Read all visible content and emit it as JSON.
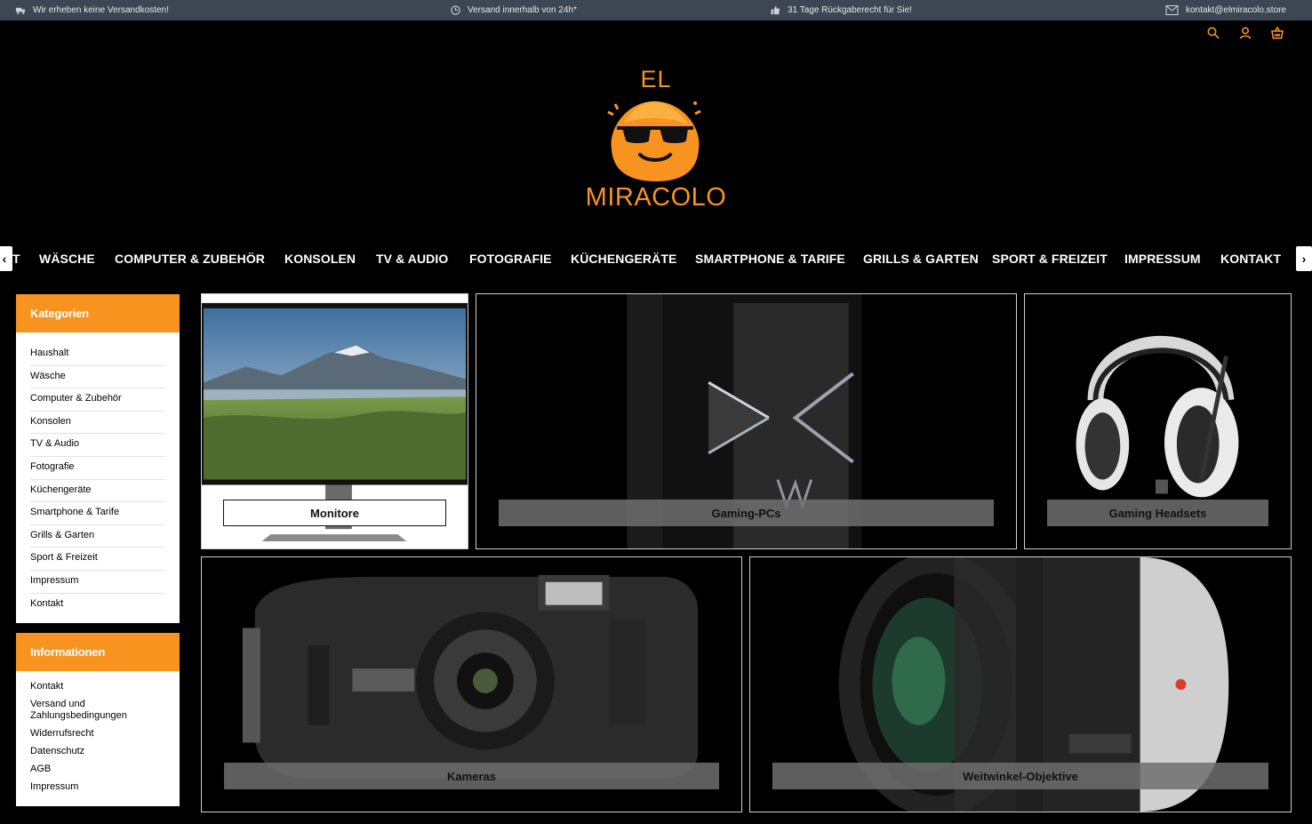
{
  "topbar": {
    "shipping_free": "Wir erheben keine Versandkosten!",
    "delivery": "Versand innerhalb von 24h*",
    "returns": "31 Tage Rückgaberecht für Sie!",
    "email": "kontakt@elmiracolo.store"
  },
  "logo": {
    "line1": "EL",
    "line2": "MIRACOLO"
  },
  "nav": {
    "prev": "‹",
    "next": "›",
    "items": [
      "T",
      "WÄSCHE",
      "COMPUTER & ZUBEHÖR",
      "KONSOLEN",
      "TV & AUDIO",
      "FOTOGRAFIE",
      "KÜCHENGERÄTE",
      "SMARTPHONE & TARIFE",
      "GRILLS & GARTEN",
      "SPORT & FREIZEIT",
      "IMPRESSUM",
      "KONTAKT"
    ]
  },
  "categories": {
    "title": "Kategorien",
    "items": [
      "Haushalt",
      "Wäsche",
      "Computer & Zubehör",
      "Konsolen",
      "TV & Audio",
      "Fotografie",
      "Küchengeräte",
      "Smartphone & Tarife",
      "Grills & Garten",
      "Sport & Freizeit",
      "Impressum",
      "Kontakt"
    ]
  },
  "info": {
    "title": "Informationen",
    "items": [
      "Kontakt",
      "Versand und Zahlungsbedingungen",
      "Widerrufsrecht",
      "Datenschutz",
      "AGB",
      "Impressum"
    ]
  },
  "tiles": {
    "monitore": "Monitore",
    "gaming_pcs": "Gaming-PCs",
    "headsets": "Gaming Headsets",
    "kameras": "Kameras",
    "objektive": "Weitwinkel-Objektive"
  },
  "colors": {
    "accent": "#f7931e",
    "topbar": "#3d4754",
    "background": "#000000"
  }
}
